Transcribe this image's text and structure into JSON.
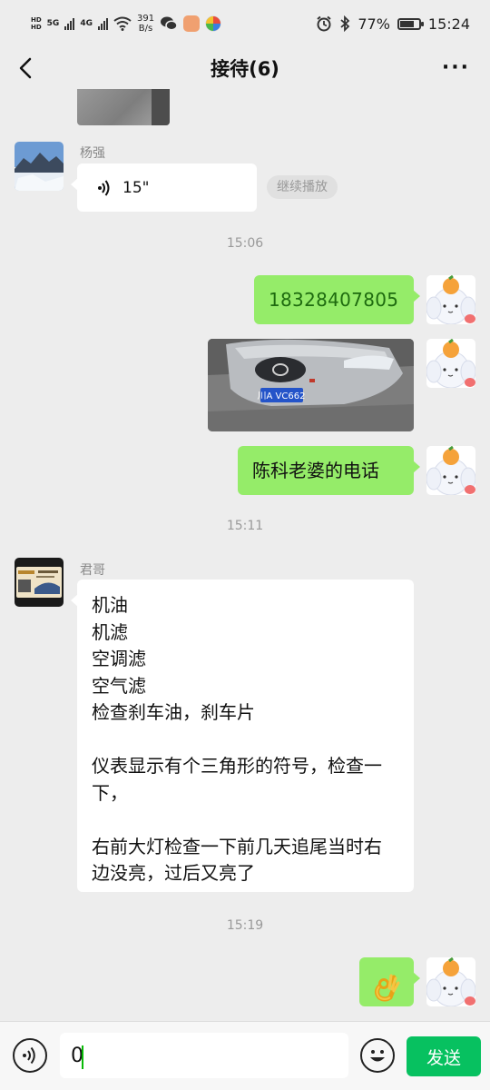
{
  "status_bar": {
    "hd1": "HD",
    "hd2": "HD",
    "net1": "5G",
    "net2": "4G",
    "speed_value": "391",
    "speed_unit": "B/s",
    "battery": "77%",
    "time": "15:24",
    "battery_level": 0.77
  },
  "nav": {
    "title": "接待(6)",
    "more": "···",
    "icons": [
      "back-arrow-icon",
      "more-icon"
    ]
  },
  "messages": {
    "m1": {
      "sender": "杨强",
      "voice_duration": "15\"",
      "continue_label": "继续播放"
    },
    "t1": "15:06",
    "m2": {
      "text": "18328407805"
    },
    "m3": {
      "plate": "川A VC662"
    },
    "m4": {
      "text": "陈科老婆的电话"
    },
    "t2": "15:11",
    "m5": {
      "sender": "君哥",
      "text": "机油\n机滤\n空调滤\n空气滤\n检查刹车油，刹车片\n\n仪表显示有个三角形的符号，检查一下，\n\n右前大灯检查一下前几天追尾当时右边没亮，过后又亮了"
    },
    "t3": "15:19",
    "m6": {
      "emoji": "ok-hand-emoji"
    }
  },
  "input": {
    "value": "0",
    "send_label": "发送",
    "icons": [
      "voice-icon",
      "emoji-icon"
    ]
  },
  "colors": {
    "bubble_self": "#95ec69",
    "send_button": "#07c160",
    "background": "#ededed"
  }
}
